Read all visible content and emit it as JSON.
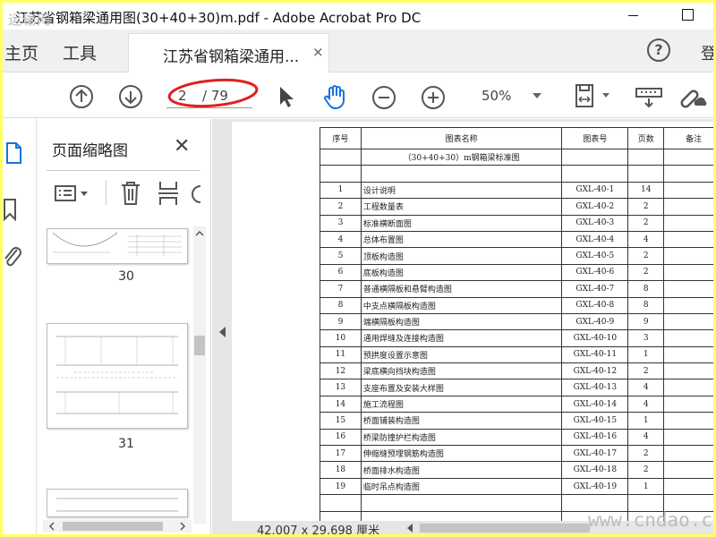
{
  "window": {
    "title": "江苏省钢箱梁通用图(30+40+30)m.pdf - Adobe Acrobat Pro DC",
    "watermark": "运输网"
  },
  "tabs": {
    "home": "主页",
    "tools": "工具",
    "document": "江苏省钢箱梁通用...",
    "close": "×",
    "help": "?",
    "signin": "登"
  },
  "toolbar": {
    "current_page": "2",
    "total_pages": "/ 79",
    "zoom": "50%"
  },
  "thumbnails": {
    "title": "页面缩略图",
    "close": "✕",
    "pages": [
      "30",
      "31"
    ]
  },
  "sheet": {
    "headers": [
      "序号",
      "图表名称",
      "图表号",
      "页数",
      "备注"
    ],
    "subtitle": "（30+40+30）m钢箱梁标准图",
    "rows": [
      {
        "no": "1",
        "name": "设计说明",
        "code": "GXL-40-1",
        "pages": "14"
      },
      {
        "no": "2",
        "name": "工程数量表",
        "code": "GXL-40-2",
        "pages": "2"
      },
      {
        "no": "3",
        "name": "标准横断面图",
        "code": "GXL-40-3",
        "pages": "2"
      },
      {
        "no": "4",
        "name": "总体布置图",
        "code": "GXL-40-4",
        "pages": "4"
      },
      {
        "no": "5",
        "name": "顶板构造图",
        "code": "GXL-40-5",
        "pages": "2"
      },
      {
        "no": "6",
        "name": "底板构造图",
        "code": "GXL-40-6",
        "pages": "2"
      },
      {
        "no": "7",
        "name": "普通横隔板和悬臂构造图",
        "code": "GXL-40-7",
        "pages": "8"
      },
      {
        "no": "8",
        "name": "中支点横隔板构造图",
        "code": "GXL-40-8",
        "pages": "8"
      },
      {
        "no": "9",
        "name": "端横隔板构造图",
        "code": "GXL-40-9",
        "pages": "9"
      },
      {
        "no": "10",
        "name": "通用焊缝及连接构造图",
        "code": "GXL-40-10",
        "pages": "3"
      },
      {
        "no": "11",
        "name": "预拱度设置示意图",
        "code": "GXL-40-11",
        "pages": "1"
      },
      {
        "no": "12",
        "name": "梁底横向挡块构造图",
        "code": "GXL-40-12",
        "pages": "2"
      },
      {
        "no": "13",
        "name": "支座布置及安装大样图",
        "code": "GXL-40-13",
        "pages": "4"
      },
      {
        "no": "14",
        "name": "施工流程图",
        "code": "GXL-40-14",
        "pages": "4"
      },
      {
        "no": "15",
        "name": "桥面铺装构造图",
        "code": "GXL-40-15",
        "pages": "1"
      },
      {
        "no": "16",
        "name": "桥梁防撞护栏构造图",
        "code": "GXL-40-16",
        "pages": "4"
      },
      {
        "no": "17",
        "name": "伸缩缝预埋钢筋构造图",
        "code": "GXL-40-17",
        "pages": "2"
      },
      {
        "no": "18",
        "name": "桥面排水构造图",
        "code": "GXL-40-18",
        "pages": "2"
      },
      {
        "no": "19",
        "name": "临时吊点构造图",
        "code": "GXL-40-19",
        "pages": "1"
      }
    ]
  },
  "status": {
    "page_size": "42.007 x 29.698 厘米"
  },
  "watermark_br": "www.cndao.com",
  "colors": {
    "border_highlight": "#ffff66",
    "annotation_red": "#e02020",
    "accent": "#1473e6"
  }
}
